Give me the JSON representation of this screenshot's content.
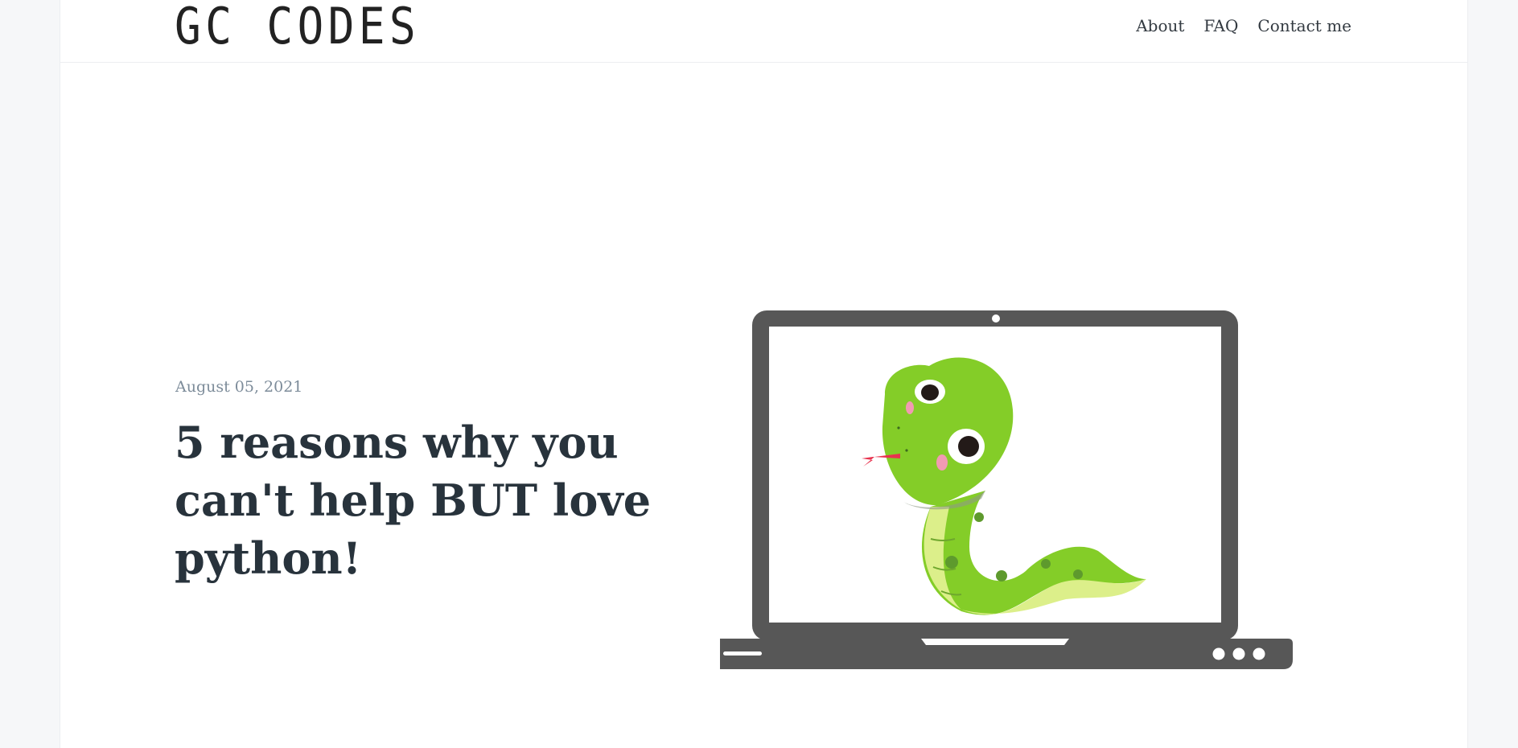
{
  "site": {
    "logo": "GC CODES"
  },
  "nav": {
    "items": [
      {
        "label": "About"
      },
      {
        "label": "FAQ"
      },
      {
        "label": "Contact me"
      }
    ]
  },
  "post": {
    "date": "August 05, 2021",
    "title": "5 reasons why you can't help BUT love python!"
  },
  "colors": {
    "background": "#f6f7f9",
    "laptop": "#575757",
    "snake_green": "#84cd28",
    "snake_belly": "#dcef8a",
    "tongue": "#e8334f"
  },
  "illustration": {
    "icon": "laptop-snake-illustration"
  }
}
